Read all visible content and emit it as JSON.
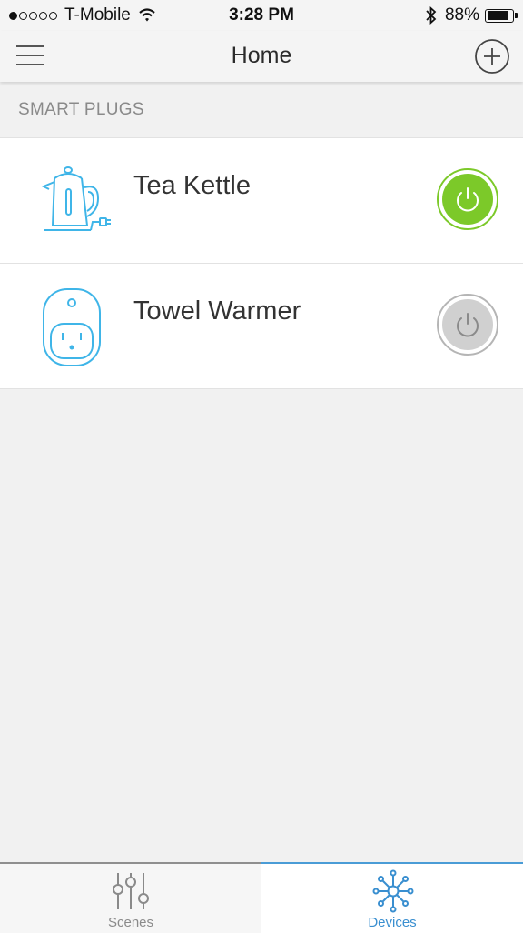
{
  "status_bar": {
    "carrier": "T-Mobile",
    "time": "3:28 PM",
    "battery_percent": "88%",
    "battery_level": 0.88,
    "signal_bars": 1
  },
  "nav": {
    "title": "Home",
    "menu_icon": "hamburger-menu-icon",
    "add_icon": "add-circle-icon"
  },
  "section": {
    "title": "SMART PLUGS"
  },
  "devices": [
    {
      "name": "Tea Kettle",
      "icon": "kettle-icon",
      "power_on": true
    },
    {
      "name": "Towel Warmer",
      "icon": "smart-plug-icon",
      "power_on": false
    }
  ],
  "tabs": [
    {
      "label": "Scenes",
      "icon": "sliders-icon",
      "active": false
    },
    {
      "label": "Devices",
      "icon": "network-hub-icon",
      "active": true
    }
  ],
  "colors": {
    "power_on": "#7cc929",
    "power_off": "#c8c8c8",
    "accent_blue": "#3a8fd0",
    "icon_blue": "#3fb5e8"
  }
}
